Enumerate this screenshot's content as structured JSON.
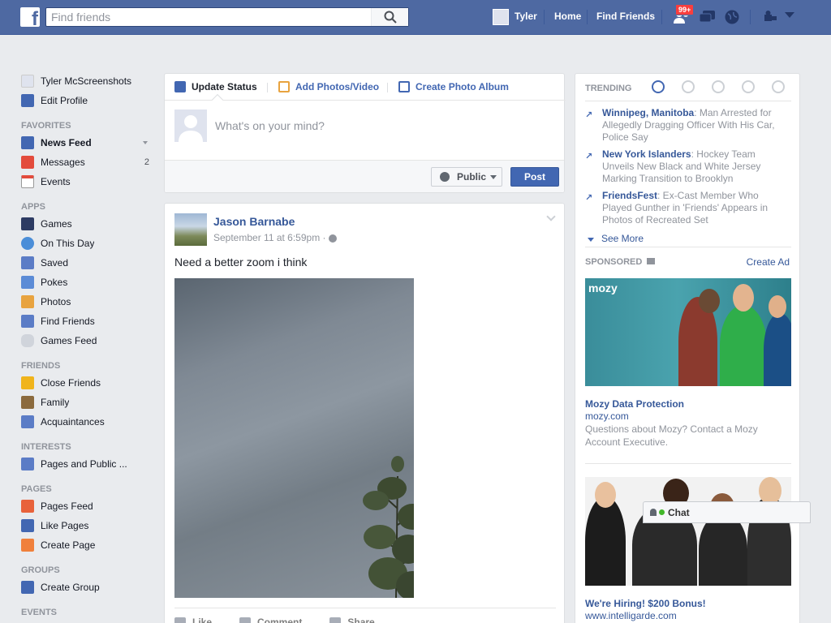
{
  "topbar": {
    "logo": "f",
    "search_placeholder": "Find friends",
    "user_name": "Tyler",
    "home": "Home",
    "find_friends": "Find Friends",
    "friend_requests_badge": "99+",
    "icons": [
      "friend-requests-icon",
      "messages-icon",
      "notifications-icon",
      "privacy-icon",
      "settings-icon"
    ]
  },
  "leftnav": {
    "profile_name": "Tyler McScreenshots",
    "edit_profile": "Edit Profile",
    "sections": {
      "favorites": "FAVORITES",
      "apps": "APPS",
      "friends": "FRIENDS",
      "interests": "INTERESTS",
      "pages": "PAGES",
      "groups": "GROUPS",
      "events": "EVENTS"
    },
    "favorites": [
      {
        "label": "News Feed",
        "color": "#4267b2"
      },
      {
        "label": "Messages",
        "count": "2",
        "color": "#e34b3c"
      },
      {
        "label": "Events",
        "color": "#ffffff"
      }
    ],
    "apps": [
      {
        "label": "Games",
        "color": "#2d3b63"
      },
      {
        "label": "On This Day",
        "color": "#4b8ed8"
      },
      {
        "label": "Saved",
        "color": "#5b7cc6"
      },
      {
        "label": "Pokes",
        "color": "#5b8bd6"
      },
      {
        "label": "Photos",
        "color": "#e8a33f"
      },
      {
        "label": "Find Friends",
        "color": "#5b7cc6"
      },
      {
        "label": "Games Feed",
        "color": "#d0d4db"
      }
    ],
    "friends": [
      {
        "label": "Close Friends",
        "color": "#f0b41c"
      },
      {
        "label": "Family",
        "color": "#8b6a3d"
      },
      {
        "label": "Acquaintances",
        "color": "#5b7cc6"
      }
    ],
    "interests": [
      {
        "label": "Pages and Public ...",
        "color": "#5b7cc6"
      }
    ],
    "pages": [
      {
        "label": "Pages Feed",
        "color": "#e8623b"
      },
      {
        "label": "Like Pages",
        "color": "#4267b2"
      },
      {
        "label": "Create Page",
        "color": "#f0803c"
      }
    ],
    "groups": [
      {
        "label": "Create Group",
        "color": "#4267b2"
      }
    ]
  },
  "composer": {
    "tabs": [
      "Update Status",
      "Add Photos/Video",
      "Create Photo Album"
    ],
    "placeholder": "What's on your mind?",
    "audience": "Public",
    "post": "Post"
  },
  "post": {
    "author": "Jason Barnabe",
    "time": "September 11 at 6:59pm · ",
    "text": "Need a better zoom i think",
    "actions": [
      "Like",
      "Comment",
      "Share"
    ]
  },
  "trending": {
    "header": "TRENDING",
    "items": [
      {
        "topic": "Winnipeg, Manitoba",
        "text": ": Man Arrested for Allegedly Dragging Officer With His Car, Police Say"
      },
      {
        "topic": "New York Islanders",
        "text": ": Hockey Team Unveils New Black and White Jersey Marking Transition to Brooklyn"
      },
      {
        "topic": "FriendsFest",
        "text": ": Ex-Cast Member Who Played Gunther in 'Friends' Appears in Photos of Recreated Set"
      }
    ],
    "see_more": "See More"
  },
  "sponsored": {
    "header": "SPONSORED",
    "create_ad": "Create Ad",
    "ads": [
      {
        "logo": "mozy",
        "title": "Mozy Data Protection",
        "url": "mozy.com",
        "desc": "Questions about Mozy? Contact a Mozy Account Executive."
      },
      {
        "title": "We're Hiring! $200 Bonus!",
        "url": "www.intelligarde.com"
      }
    ]
  },
  "chat": {
    "label": "Chat"
  },
  "colors": {
    "brand": "#4e69a2",
    "link": "#365899",
    "button": "#4267b2"
  }
}
